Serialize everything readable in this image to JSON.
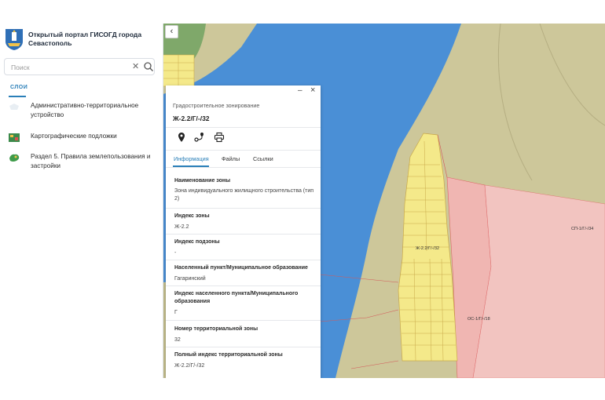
{
  "sidebar": {
    "portal_title": "Открытый портал ГИСОГД города Севастополь",
    "search": {
      "value": "",
      "placeholder": "Поиск"
    },
    "tab_layers": "СЛОИ",
    "layers": [
      {
        "label": "Административно-территориальное устройство",
        "icon": "admin-territory-icon"
      },
      {
        "label": "Картографические подложки",
        "icon": "map-basemap-icon"
      },
      {
        "label": "Раздел 5. Правила землепользования и застройки",
        "icon": "zoning-rules-icon"
      }
    ]
  },
  "map": {
    "labels": {
      "zone_main": "Ж-2.2/Г/-/32",
      "zone_sp": "СП-1/Г/-/34",
      "zone_os": "ОС-1/Г/-/18"
    },
    "colors": {
      "water": "#4a90d9",
      "land": "#c8c291",
      "zone_residential": "#f4e98a",
      "zone_pink": "#f2b8b4"
    }
  },
  "panel": {
    "kind": "Градостроительное зонирование",
    "code": "Ж-2.2/Г/-/32",
    "tabs": [
      "Информация",
      "Файлы",
      "Ссылки"
    ],
    "active_tab": 0,
    "fields": [
      {
        "label": "Наименование зоны",
        "value": "Зона индивидуального жилищного строительства (тип 2)"
      },
      {
        "label": "Индекс зоны",
        "value": "Ж-2.2"
      },
      {
        "label": "Индекс подзоны",
        "value": "-"
      },
      {
        "label": "Населенный пункт/Муниципальное образование",
        "value": "Гагаринский"
      },
      {
        "label": "Индекс населенного пункта/Муниципального образования",
        "value": "Г"
      },
      {
        "label": "Номер территориальной зоны",
        "value": "32"
      },
      {
        "label": "Полный индекс территориальной зоны",
        "value": "Ж-2.2/Г/-/32"
      }
    ]
  }
}
